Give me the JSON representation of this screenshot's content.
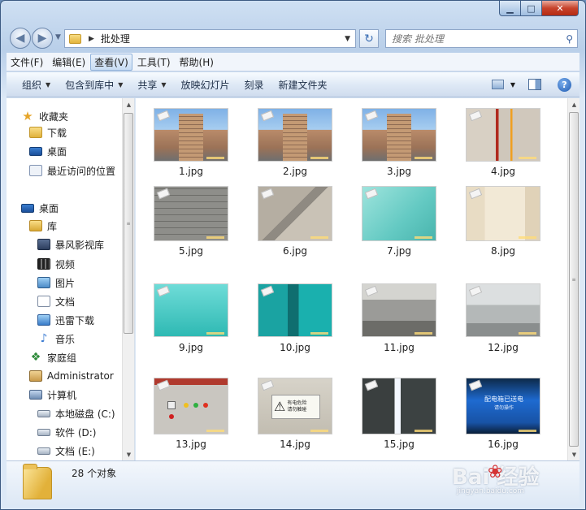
{
  "window": {
    "minimize_glyph": "▁",
    "maximize_glyph": "□",
    "close_glyph": "✕"
  },
  "nav": {
    "back_glyph": "◀",
    "forward_glyph": "▶",
    "address_path": "批处理",
    "search_placeholder": "搜索 批处理",
    "refresh_glyph": "↻"
  },
  "menu": [
    {
      "label": "文件(F)",
      "active": false
    },
    {
      "label": "编辑(E)",
      "active": false
    },
    {
      "label": "查看(V)",
      "active": true
    },
    {
      "label": "工具(T)",
      "active": false
    },
    {
      "label": "帮助(H)",
      "active": false
    }
  ],
  "commands": [
    {
      "label": "组织",
      "dropdown": true
    },
    {
      "label": "包含到库中",
      "dropdown": true
    },
    {
      "label": "共享",
      "dropdown": true
    },
    {
      "label": "放映幻灯片",
      "dropdown": false
    },
    {
      "label": "刻录",
      "dropdown": false
    },
    {
      "label": "新建文件夹",
      "dropdown": false
    }
  ],
  "sidebar": {
    "items": [
      {
        "label": "收藏夹",
        "icon": "star-icon",
        "indent": 0
      },
      {
        "label": "下载",
        "icon": "download-folder-icon",
        "indent": 1
      },
      {
        "label": "桌面",
        "icon": "desktop-icon",
        "indent": 1
      },
      {
        "label": "最近访问的位置",
        "icon": "recent-places-icon",
        "indent": 1
      },
      {
        "label": "桌面",
        "icon": "desktop-icon",
        "indent": 0
      },
      {
        "label": "库",
        "icon": "library-icon",
        "indent": 1
      },
      {
        "label": "暴风影视库",
        "icon": "video-library-icon",
        "indent": 2
      },
      {
        "label": "视频",
        "icon": "film-icon",
        "indent": 2
      },
      {
        "label": "图片",
        "icon": "picture-icon",
        "indent": 2
      },
      {
        "label": "文档",
        "icon": "document-icon",
        "indent": 2
      },
      {
        "label": "迅雷下载",
        "icon": "thunder-download-icon",
        "indent": 2
      },
      {
        "label": "音乐",
        "icon": "music-icon",
        "indent": 2
      },
      {
        "label": "家庭组",
        "icon": "homegroup-icon",
        "indent": 1
      },
      {
        "label": "Administrator",
        "icon": "user-folder-icon",
        "indent": 1
      },
      {
        "label": "计算机",
        "icon": "computer-icon",
        "indent": 1
      },
      {
        "label": "本地磁盘 (C:)",
        "icon": "drive-icon",
        "indent": 2
      },
      {
        "label": "软件 (D:)",
        "icon": "drive-icon",
        "indent": 2
      },
      {
        "label": "文档 (E:)",
        "icon": "drive-icon",
        "indent": 2
      }
    ]
  },
  "files": [
    {
      "name": "1.jpg",
      "scene": "building"
    },
    {
      "name": "2.jpg",
      "scene": "building"
    },
    {
      "name": "3.jpg",
      "scene": "building"
    },
    {
      "name": "4.jpg",
      "scene": "room-red"
    },
    {
      "name": "5.jpg",
      "scene": "brick-wall"
    },
    {
      "name": "6.jpg",
      "scene": "ceiling-corner"
    },
    {
      "name": "7.jpg",
      "scene": "teal-wall"
    },
    {
      "name": "8.jpg",
      "scene": "beige-room"
    },
    {
      "name": "9.jpg",
      "scene": "teal-pipe"
    },
    {
      "name": "10.jpg",
      "scene": "teal-dark-pipe"
    },
    {
      "name": "11.jpg",
      "scene": "gray-pipes"
    },
    {
      "name": "12.jpg",
      "scene": "gray-pipes-light"
    },
    {
      "name": "13.jpg",
      "scene": "control-panel"
    },
    {
      "name": "14.jpg",
      "scene": "warning-sign"
    },
    {
      "name": "15.jpg",
      "scene": "light-tube"
    },
    {
      "name": "16.jpg",
      "scene": "blue-sign"
    }
  ],
  "signs": {
    "warning_line1": "有电危险",
    "warning_line2": "请勿触碰",
    "blue_line1": "配电箱已送电",
    "blue_line2": "请勿操作"
  },
  "status": {
    "item_count": "28 个对象"
  },
  "watermark": {
    "text": "Bai  经验",
    "sub": "jingyan.baidu.com"
  }
}
